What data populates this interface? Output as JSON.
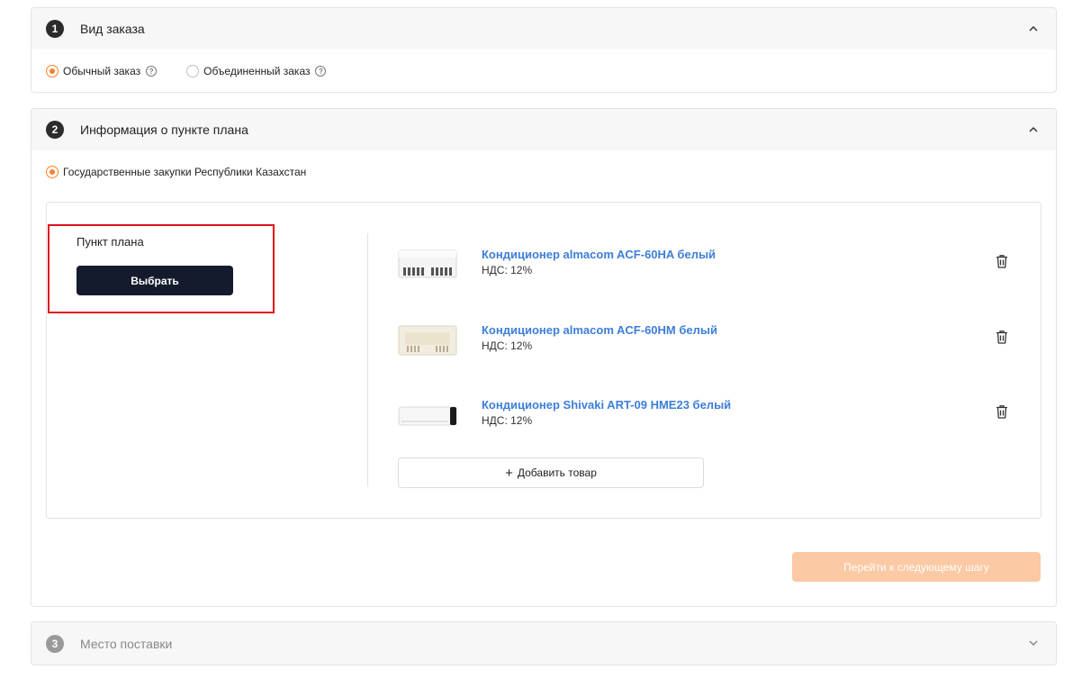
{
  "order_type": {
    "step": "1",
    "title": "Вид заказа",
    "options": [
      {
        "label": "Обычный заказ",
        "checked": true
      },
      {
        "label": "Объединенный заказ",
        "checked": false
      }
    ]
  },
  "plan_info": {
    "step": "2",
    "title": "Информация о пункте плана",
    "source_option": "Государственные закупки Республики Казахстан",
    "plan_item_label": "Пункт плана",
    "choose_button": "Выбрать",
    "products": [
      {
        "name": "Кондиционер almacom ACF-60HA белый",
        "vat": "НДС: 12%",
        "image_icon": "ceiling-ac-icon"
      },
      {
        "name": "Кондиционер almacom ACF-60HM белый",
        "vat": "НДС: 12%",
        "image_icon": "ceiling-ac-cream-icon"
      },
      {
        "name": "Кондиционер Shivaki ART-09 HME23 белый",
        "vat": "НДС: 12%",
        "image_icon": "wall-ac-icon"
      }
    ],
    "add_product_button": "Добавить товар",
    "next_step_button": "Перейти к следующему шагу"
  },
  "delivery": {
    "step": "3",
    "title": "Место поставки"
  },
  "colors": {
    "accent": "#f5822a",
    "link": "#3d7ed8",
    "dark_button": "#141b2d",
    "disabled_button": "#fbc9a4",
    "highlight_border": "#e0121a"
  }
}
